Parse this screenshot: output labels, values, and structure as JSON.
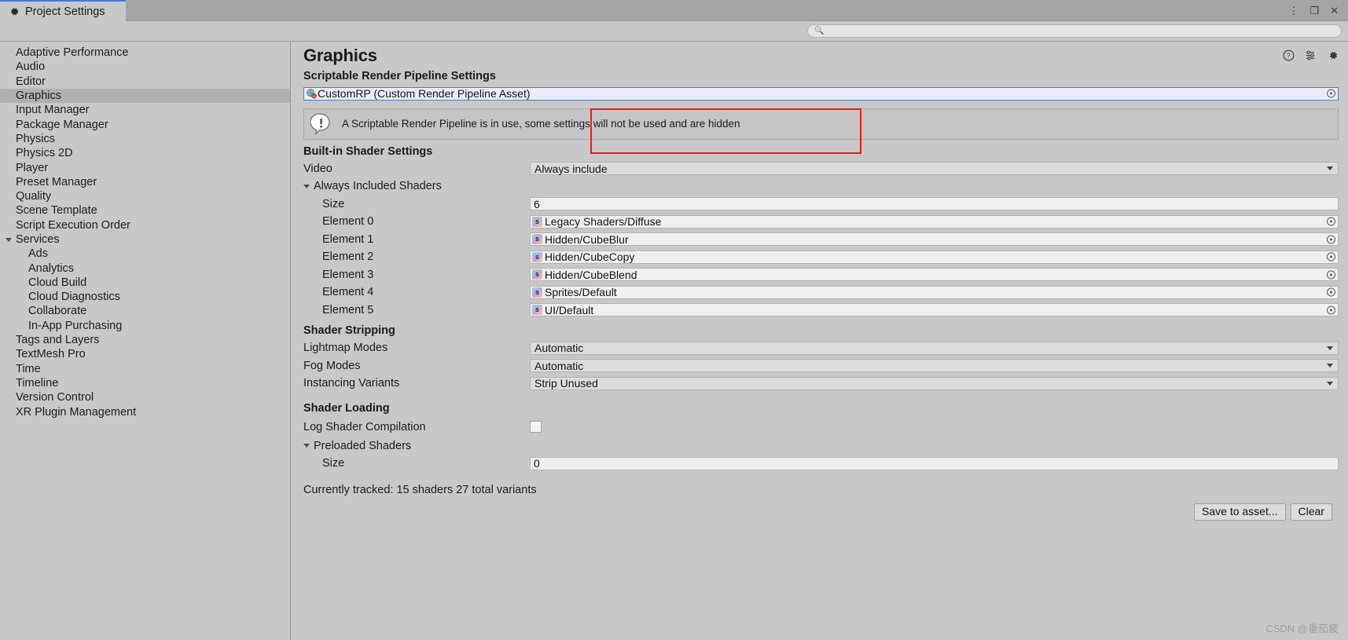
{
  "window": {
    "tab_label": "Project Settings",
    "tab_icon": "gear-icon",
    "menu_icon": "kebab-menu-icon",
    "maximize_icon": "maximize-icon",
    "close_icon": "close-icon"
  },
  "search": {
    "placeholder": "",
    "value": "",
    "icon": "search-icon"
  },
  "sidebar": {
    "items": [
      {
        "label": "Adaptive Performance",
        "indent": 0,
        "selected": false,
        "expandable": false
      },
      {
        "label": "Audio",
        "indent": 0,
        "selected": false,
        "expandable": false
      },
      {
        "label": "Editor",
        "indent": 0,
        "selected": false,
        "expandable": false
      },
      {
        "label": "Graphics",
        "indent": 0,
        "selected": true,
        "expandable": false
      },
      {
        "label": "Input Manager",
        "indent": 0,
        "selected": false,
        "expandable": false
      },
      {
        "label": "Package Manager",
        "indent": 0,
        "selected": false,
        "expandable": false
      },
      {
        "label": "Physics",
        "indent": 0,
        "selected": false,
        "expandable": false
      },
      {
        "label": "Physics 2D",
        "indent": 0,
        "selected": false,
        "expandable": false
      },
      {
        "label": "Player",
        "indent": 0,
        "selected": false,
        "expandable": false
      },
      {
        "label": "Preset Manager",
        "indent": 0,
        "selected": false,
        "expandable": false
      },
      {
        "label": "Quality",
        "indent": 0,
        "selected": false,
        "expandable": false
      },
      {
        "label": "Scene Template",
        "indent": 0,
        "selected": false,
        "expandable": false
      },
      {
        "label": "Script Execution Order",
        "indent": 0,
        "selected": false,
        "expandable": false
      },
      {
        "label": "Services",
        "indent": 0,
        "selected": false,
        "expandable": true
      },
      {
        "label": "Ads",
        "indent": 1,
        "selected": false,
        "expandable": false
      },
      {
        "label": "Analytics",
        "indent": 1,
        "selected": false,
        "expandable": false
      },
      {
        "label": "Cloud Build",
        "indent": 1,
        "selected": false,
        "expandable": false
      },
      {
        "label": "Cloud Diagnostics",
        "indent": 1,
        "selected": false,
        "expandable": false
      },
      {
        "label": "Collaborate",
        "indent": 1,
        "selected": false,
        "expandable": false
      },
      {
        "label": "In-App Purchasing",
        "indent": 1,
        "selected": false,
        "expandable": false
      },
      {
        "label": "Tags and Layers",
        "indent": 0,
        "selected": false,
        "expandable": false
      },
      {
        "label": "TextMesh Pro",
        "indent": 0,
        "selected": false,
        "expandable": false
      },
      {
        "label": "Time",
        "indent": 0,
        "selected": false,
        "expandable": false
      },
      {
        "label": "Timeline",
        "indent": 0,
        "selected": false,
        "expandable": false
      },
      {
        "label": "Version Control",
        "indent": 0,
        "selected": false,
        "expandable": false
      },
      {
        "label": "XR Plugin Management",
        "indent": 0,
        "selected": false,
        "expandable": false
      }
    ]
  },
  "main": {
    "title": "Graphics",
    "header_icons": [
      "help-icon",
      "preset-icon",
      "settings-gear-icon"
    ],
    "srp": {
      "section_label": "Scriptable Render Pipeline Settings",
      "asset_value": "CustomRP (Custom Render Pipeline Asset)",
      "asset_icon": "render-pipeline-asset-icon",
      "highlight_color": "#f61717"
    },
    "warning": {
      "icon": "warning-icon",
      "message": "A Scriptable Render Pipeline is in use, some settings will not be used and are hidden"
    },
    "builtin": {
      "section_label": "Built-in Shader Settings",
      "video_label": "Video",
      "video_value": "Always include",
      "always_included_label": "Always Included Shaders",
      "size_label": "Size",
      "size_value": "6",
      "elements": [
        {
          "label": "Element 0",
          "value": "Legacy Shaders/Diffuse",
          "icon": "shader-icon"
        },
        {
          "label": "Element 1",
          "value": "Hidden/CubeBlur",
          "icon": "shader-icon"
        },
        {
          "label": "Element 2",
          "value": "Hidden/CubeCopy",
          "icon": "shader-icon"
        },
        {
          "label": "Element 3",
          "value": "Hidden/CubeBlend",
          "icon": "shader-icon"
        },
        {
          "label": "Element 4",
          "value": "Sprites/Default",
          "icon": "shader-icon"
        },
        {
          "label": "Element 5",
          "value": "UI/Default",
          "icon": "shader-icon"
        }
      ]
    },
    "stripping": {
      "section_label": "Shader Stripping",
      "rows": [
        {
          "label": "Lightmap Modes",
          "value": "Automatic"
        },
        {
          "label": "Fog Modes",
          "value": "Automatic"
        },
        {
          "label": "Instancing Variants",
          "value": "Strip Unused"
        }
      ]
    },
    "loading": {
      "section_label": "Shader Loading",
      "log_label": "Log Shader Compilation",
      "log_checked": false,
      "preloaded_label": "Preloaded Shaders",
      "size_label": "Size",
      "size_value": "0"
    },
    "status_text": "Currently tracked: 15 shaders 27 total variants",
    "buttons": {
      "save": "Save to asset...",
      "clear": "Clear"
    }
  },
  "watermark": "CSDN @番茄疲"
}
